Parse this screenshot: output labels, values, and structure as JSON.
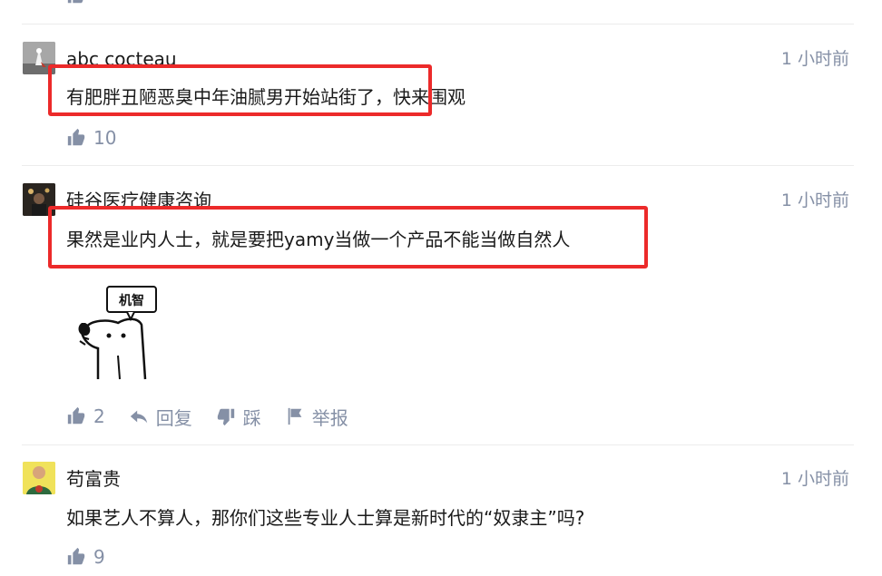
{
  "comments": [
    {
      "author": "abc cocteau",
      "time": "1 小时前",
      "text": "有肥胖丑陋恶臭中年油腻男开始站街了，快来围观",
      "likes": "10"
    },
    {
      "author": "硅谷医疗健康咨询",
      "time": "1 小时前",
      "text": "果然是业内人士，就是要把yamy当做一个产品不能当做自然人",
      "sticker_text": "机智",
      "likes": "2",
      "reply_label": "回复",
      "dislike_label": "踩",
      "report_label": "举报"
    },
    {
      "author": "苟富贵",
      "time": "1 小时前",
      "text": "如果艺人不算人，那你们这些专业人士算是新时代的“奴隶主”吗?",
      "likes": "9"
    }
  ],
  "colors": {
    "accent_red": "#ec2a2a",
    "meta_gray": "#8590a6"
  },
  "icons": [
    "thumbs-up-icon",
    "reply-icon",
    "thumbs-down-icon",
    "flag-icon"
  ]
}
